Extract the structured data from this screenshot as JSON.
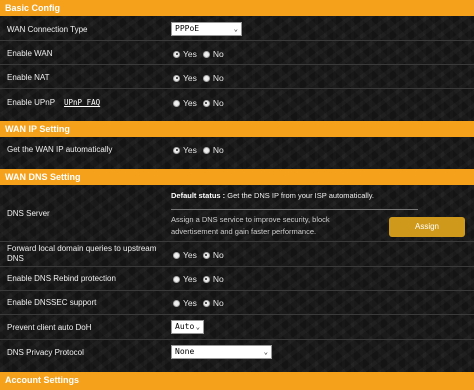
{
  "sections": {
    "basic": "Basic Config",
    "wan_ip": "WAN IP Setting",
    "wan_dns": "WAN DNS Setting",
    "account": "Account Settings"
  },
  "rows": {
    "conn_type": {
      "label": "WAN Connection Type",
      "value": "PPPoE"
    },
    "enable_wan": {
      "label": "Enable WAN",
      "yes": "Yes",
      "no": "No",
      "selected": "yes"
    },
    "enable_nat": {
      "label": "Enable NAT",
      "yes": "Yes",
      "no": "No",
      "selected": "yes"
    },
    "enable_upnp": {
      "label": "Enable UPnP",
      "link": "UPnP FAQ",
      "yes": "Yes",
      "no": "No",
      "selected": "no"
    },
    "get_wan_ip": {
      "label": "Get the WAN IP automatically",
      "yes": "Yes",
      "no": "No",
      "selected": "yes"
    },
    "dns_server": {
      "label": "DNS Server",
      "status_label": "Default status :",
      "status_text": "Get the DNS IP from your ISP automatically.",
      "description": "Assign a DNS service to improve security, block advertisement and gain faster performance.",
      "assign_button": "Assign"
    },
    "forward_local": {
      "label": "Forward local domain queries to upstream DNS",
      "yes": "Yes",
      "no": "No",
      "selected": "no"
    },
    "rebind": {
      "label": "Enable DNS Rebind protection",
      "yes": "Yes",
      "no": "No",
      "selected": "no"
    },
    "dnssec": {
      "label": "Enable DNSSEC support",
      "yes": "Yes",
      "no": "No",
      "selected": "no"
    },
    "doh": {
      "label": "Prevent client auto DoH",
      "value": "Auto"
    },
    "privacy": {
      "label": "DNS Privacy Protocol",
      "value": "None"
    }
  },
  "icons": {
    "dropdown": "chevron-down-icon"
  },
  "colors": {
    "section_bar": "#f5a11b",
    "assign_button": "#cf9a1b"
  }
}
